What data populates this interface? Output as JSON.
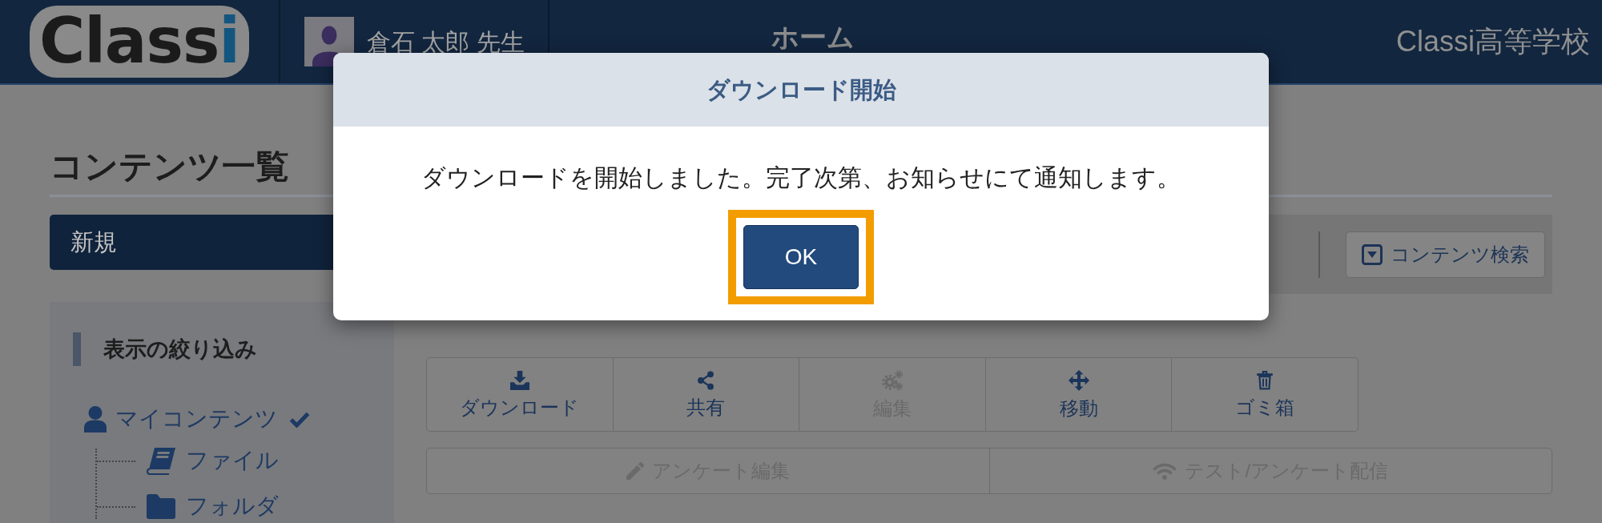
{
  "header": {
    "logo": "Classi",
    "user_name": "倉石 太郎 先生",
    "page_title": "ホーム",
    "school_name": "Classi高等学校"
  },
  "content": {
    "heading": "コンテンツ一覧",
    "new_button": "新規",
    "search_button": "コンテンツ検索"
  },
  "sidebar": {
    "title": "表示の絞り込み",
    "tree": [
      {
        "label": "マイコンテンツ",
        "kind": "user",
        "checked": true,
        "children": [
          {
            "label": "ファイル",
            "kind": "file",
            "checked": false
          },
          {
            "label": "フォルダ",
            "kind": "folder",
            "checked": false
          }
        ]
      }
    ]
  },
  "toolbar": {
    "buttons": [
      {
        "label": "ダウンロード",
        "kind": "download",
        "disabled": false
      },
      {
        "label": "共有",
        "kind": "share",
        "disabled": false
      },
      {
        "label": "編集",
        "kind": "settings",
        "disabled": true
      },
      {
        "label": "移動",
        "kind": "move",
        "disabled": false
      },
      {
        "label": "ゴミ箱",
        "kind": "delete",
        "disabled": false
      }
    ],
    "secondary_buttons": [
      {
        "label": "アンケート編集",
        "kind": "edit",
        "disabled": true
      },
      {
        "label": "テスト/アンケート配信",
        "kind": "broadcast",
        "disabled": true
      }
    ]
  },
  "dialog": {
    "title": "ダウンロード開始",
    "message": "ダウンロードを開始しました。完了次第、お知らせにて通知します。",
    "button": {
      "label": "OK",
      "highlighted": true
    }
  }
}
